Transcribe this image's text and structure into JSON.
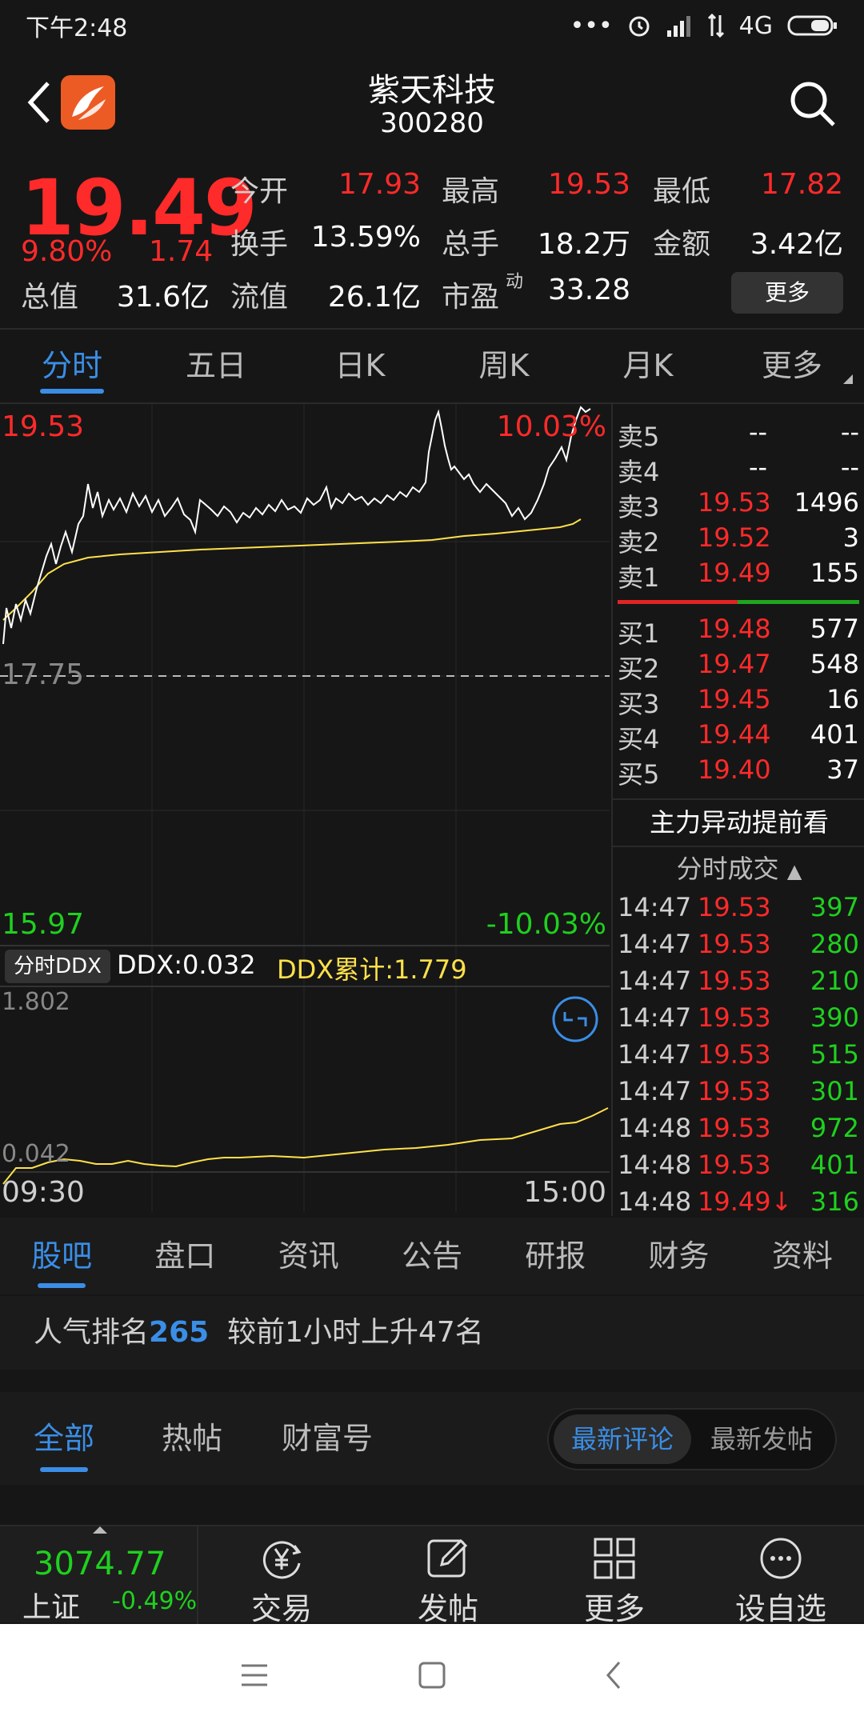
{
  "status_bar": {
    "time": "下午2:48",
    "network": "4G"
  },
  "header": {
    "name": "紫天科技",
    "code": "300280"
  },
  "quote": {
    "price": "19.49",
    "change_pct": "9.80%",
    "change": "1.74",
    "fields": [
      {
        "label": "今开",
        "value": "17.93",
        "red": true
      },
      {
        "label": "最高",
        "value": "19.53",
        "red": true
      },
      {
        "label": "最低",
        "value": "17.82",
        "red": true
      },
      {
        "label": "换手",
        "value": "13.59%",
        "red": false
      },
      {
        "label": "总手",
        "value": "18.2万",
        "red": false
      },
      {
        "label": "金额",
        "value": "3.42亿",
        "red": false
      },
      {
        "label": "总值",
        "value": "31.6亿",
        "red": false
      },
      {
        "label": "流值",
        "value": "26.1亿",
        "red": false
      },
      {
        "label": "市盈",
        "value": "33.28",
        "red": false
      }
    ],
    "pe_superscript": "动",
    "more_label": "更多"
  },
  "chart_tabs": [
    "分时",
    "五日",
    "日K",
    "周K",
    "月K",
    "更多"
  ],
  "chart": {
    "high": "19.53",
    "high_pct": "10.03%",
    "prev_close": "17.75",
    "low": "15.97",
    "low_pct": "-10.03%",
    "start_time": "09:30",
    "end_time": "15:00"
  },
  "ddx": {
    "tag": "分时DDX",
    "value": "DDX:0.032",
    "cumulative": "DDX累计:1.779",
    "max": "1.802",
    "min": "0.042"
  },
  "order_book": {
    "asks": [
      {
        "label": "卖5",
        "price": "--",
        "volume": "--"
      },
      {
        "label": "卖4",
        "price": "--",
        "volume": "--"
      },
      {
        "label": "卖3",
        "price": "19.53",
        "volume": "1496"
      },
      {
        "label": "卖2",
        "price": "19.52",
        "volume": "3"
      },
      {
        "label": "卖1",
        "price": "19.49",
        "volume": "155"
      }
    ],
    "bids": [
      {
        "label": "买1",
        "price": "19.48",
        "volume": "577"
      },
      {
        "label": "买2",
        "price": "19.47",
        "volume": "548"
      },
      {
        "label": "买3",
        "price": "19.45",
        "volume": "16"
      },
      {
        "label": "买4",
        "price": "19.44",
        "volume": "401"
      },
      {
        "label": "买5",
        "price": "19.40",
        "volume": "37"
      }
    ],
    "banner": "主力异动提前看",
    "ticks_title": "分时成交",
    "ticks": [
      {
        "time": "14:47",
        "price": "19.53",
        "volume": "397"
      },
      {
        "time": "14:47",
        "price": "19.53",
        "volume": "280"
      },
      {
        "time": "14:47",
        "price": "19.53",
        "volume": "210"
      },
      {
        "time": "14:47",
        "price": "19.53",
        "volume": "390"
      },
      {
        "time": "14:47",
        "price": "19.53",
        "volume": "515"
      },
      {
        "time": "14:47",
        "price": "19.53",
        "volume": "301"
      },
      {
        "time": "14:48",
        "price": "19.53",
        "volume": "972"
      },
      {
        "time": "14:48",
        "price": "19.53",
        "volume": "401"
      },
      {
        "time": "14:48",
        "price": "19.49↓",
        "volume": "316"
      }
    ]
  },
  "sub_tabs": [
    "股吧",
    "盘口",
    "资讯",
    "公告",
    "研报",
    "财务",
    "资料"
  ],
  "rank": {
    "prefix": "人气排名",
    "number": "265",
    "suffix": "较前1小时上升47名"
  },
  "post_tabs": [
    "全部",
    "热帖",
    "财富号"
  ],
  "sort_toggle": {
    "active": "最新评论",
    "inactive": "最新发帖"
  },
  "bottom_nav": {
    "index_value": "3074.77",
    "index_name": "上证",
    "index_pct": "-0.49%",
    "items": [
      "交易",
      "发帖",
      "更多",
      "设自选"
    ]
  },
  "colors": {
    "up": "#ff2a2a",
    "down": "#1fd01f",
    "accent": "#3a8ee6",
    "avg_line": "#ffe14a"
  }
}
